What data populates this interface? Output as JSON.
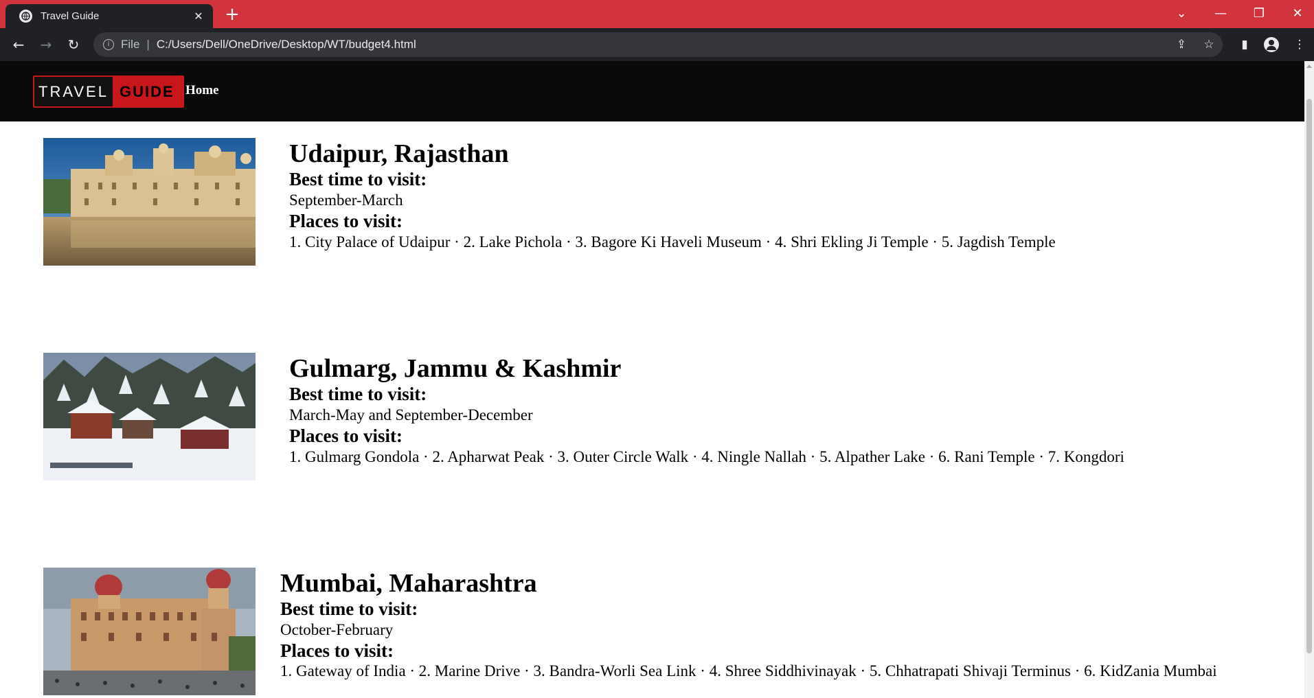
{
  "browser": {
    "tab_title": "Travel Guide",
    "url_scheme": "File",
    "url": "C:/Users/Dell/OneDrive/Desktop/WT/budget4.html"
  },
  "site": {
    "logo_part1": "TRAVEL",
    "logo_part2": "GUIDE",
    "nav_home": "Home",
    "brand_color": "#c8161d"
  },
  "best_time_label": "Best time to visit:",
  "places_label": "Places to visit:",
  "destinations": [
    {
      "name": "Udaipur, Rajasthan",
      "best_time": "September-March",
      "places": "1. City Palace of Udaipur · 2. Lake Pichola · 3. Bagore Ki Haveli Museum · 4. Shri Ekling Ji Temple · 5. Jagdish Temple"
    },
    {
      "name": "Gulmarg, Jammu & Kashmir",
      "best_time": "March-May and September-December",
      "places": "1. Gulmarg Gondola · 2. Apharwat Peak · 3. Outer Circle Walk · 4. Ningle Nallah · 5. Alpather Lake · 6. Rani Temple · 7. Kongdori"
    },
    {
      "name": "Mumbai, Maharashtra",
      "best_time": "October-February",
      "places": "1. Gateway of India · 2. Marine Drive · 3. Bandra-Worli Sea Link · 4. Shree Siddhivinayak · 5. Chhatrapati Shivaji Terminus · 6. KidZania Mumbai"
    }
  ]
}
